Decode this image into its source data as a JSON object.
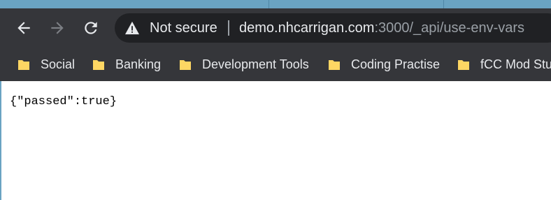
{
  "browser": {
    "security_label": "Not secure",
    "url_host": "demo.nhcarrigan.com",
    "url_path": ":3000/_api/use-env-vars",
    "icons": {
      "back": "arrow-left-icon",
      "forward": "arrow-right-icon",
      "reload": "reload-icon",
      "security": "warning-triangle-icon",
      "bookmark_folder": "folder-icon"
    }
  },
  "bookmarks": [
    {
      "label": "Social"
    },
    {
      "label": "Banking"
    },
    {
      "label": "Development Tools"
    },
    {
      "label": "Coding Practise"
    },
    {
      "label": "fCC Mod Stuff"
    }
  ],
  "page": {
    "body_text": "{\"passed\":true}"
  },
  "colors": {
    "toolbar": "#35363a",
    "omnibox": "#202124",
    "folder": "#fdd663",
    "text": "#e8eaed"
  }
}
